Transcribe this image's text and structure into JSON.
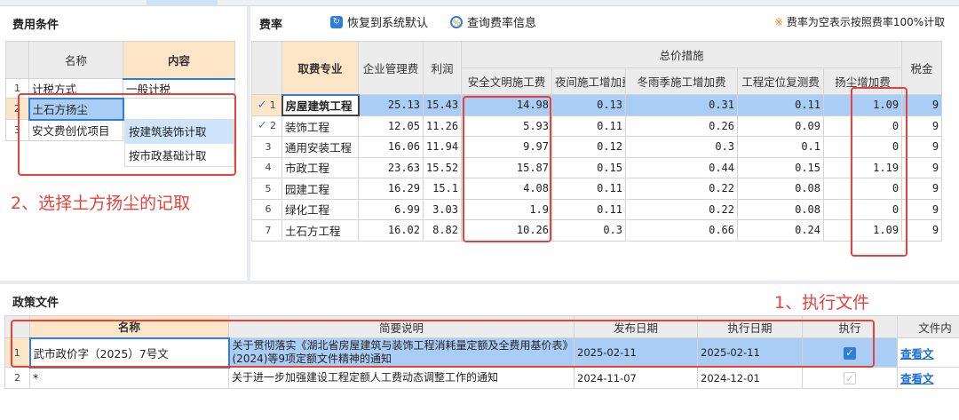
{
  "left": {
    "title": "费用条件",
    "headers": [
      "名称",
      "内容"
    ],
    "rows": [
      {
        "no": "1",
        "name": "计税方式",
        "value": "一般计税"
      },
      {
        "no": "2",
        "name": "土石方扬尘",
        "value": "按建筑装饰计取"
      },
      {
        "no": "3",
        "name": "安文费创优项目",
        "value": ""
      }
    ],
    "dropdown_options": [
      "按建筑装饰计取",
      "按市政基础计取"
    ],
    "annotation": "2、选择土方扬尘的记取"
  },
  "rates": {
    "title": "费率",
    "restore_btn": "恢复到系统默认",
    "query_btn": "查询费率信息",
    "note": "费率为空表示按照费率100%计取",
    "headers": {
      "major": "取费专业",
      "mgmt": "企业管理费",
      "profit": "利润",
      "group": "总价措施",
      "tax": "税金",
      "sub": [
        "安全文明施工费",
        "夜间施工增加费",
        "冬雨季施工增加费",
        "工程定位复测费",
        "扬尘增加费"
      ]
    },
    "rows": [
      {
        "no": "1",
        "check": "✓",
        "major": "房屋建筑工程",
        "v": [
          "25.13",
          "15.43",
          "14.98",
          "0.13",
          "0.31",
          "0.11",
          "1.09",
          "9"
        ]
      },
      {
        "no": "2",
        "check": "✓",
        "major": "装饰工程",
        "v": [
          "12.05",
          "11.26",
          "5.93",
          "0.11",
          "0.26",
          "0.09",
          "0",
          "9"
        ]
      },
      {
        "no": "3",
        "check": "",
        "major": "通用安装工程",
        "v": [
          "16.06",
          "11.94",
          "9.97",
          "0.12",
          "0.3",
          "0.1",
          "0",
          "9"
        ]
      },
      {
        "no": "4",
        "check": "",
        "major": "市政工程",
        "v": [
          "23.63",
          "15.52",
          "15.87",
          "0.15",
          "0.44",
          "0.15",
          "1.19",
          "9"
        ]
      },
      {
        "no": "5",
        "check": "",
        "major": "园建工程",
        "v": [
          "16.29",
          "15.1",
          "4.08",
          "0.11",
          "0.22",
          "0.08",
          "0",
          "9"
        ]
      },
      {
        "no": "6",
        "check": "",
        "major": "绿化工程",
        "v": [
          "6.99",
          "3.03",
          "1.9",
          "0.11",
          "0.22",
          "0.08",
          "0",
          "9"
        ]
      },
      {
        "no": "7",
        "check": "",
        "major": "土石方工程",
        "v": [
          "16.02",
          "8.82",
          "10.26",
          "0.3",
          "0.66",
          "0.24",
          "1.09",
          "9"
        ]
      }
    ]
  },
  "policy": {
    "title": "政策文件",
    "annotation": "1、执行文件",
    "headers": [
      "名称",
      "简要说明",
      "发布日期",
      "执行日期",
      "执行",
      "文件内"
    ],
    "rows": [
      {
        "no": "1",
        "name": "武市政价字（2025）7号文",
        "desc": "关于贯彻落实《湖北省房屋建筑与装饰工程消耗量定额及全费用基价表》(2024)等9项定额文件精神的通知",
        "pub": "2025-02-11",
        "exec": "2025-02-11",
        "checked": true,
        "link": "查看文"
      },
      {
        "no": "2",
        "name": "*",
        "desc": "关于进一步加强建设工程定额人工费动态调整工作的通知",
        "pub": "2024-11-07",
        "exec": "2024-12-01",
        "checked": false,
        "link": "查看文"
      }
    ]
  },
  "colors": {
    "accent": "#2f7fd8",
    "selected_row": "#a9cdf5",
    "header_highlight": "#fde5c8",
    "annotation": "#e8413a"
  }
}
